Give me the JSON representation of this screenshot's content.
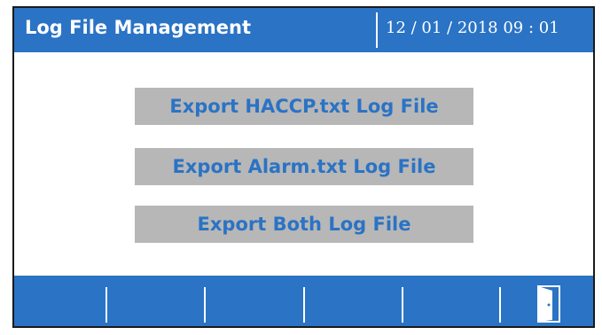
{
  "header": {
    "title": "Log File Management",
    "datetime": "12 / 01 / 2018   09 : 01"
  },
  "actions": {
    "export_haccp": "Export HACCP.txt Log File",
    "export_alarm": "Export Alarm.txt Log File",
    "export_both": "Export Both Log File"
  },
  "footer": {
    "exit_icon": "exit-door-icon"
  },
  "colors": {
    "accent": "#2a73c5",
    "button_bg": "#b7b7b7"
  }
}
